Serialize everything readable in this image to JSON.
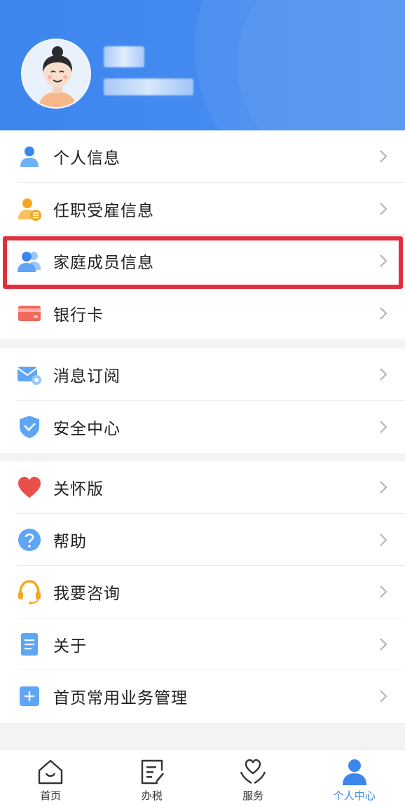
{
  "profile": {
    "avatar_icon": "female-avatar",
    "name_masked": "",
    "id_masked": ""
  },
  "groups": [
    {
      "items": [
        {
          "label": "个人信息",
          "icon": "person-icon"
        },
        {
          "label": "任职受雇信息",
          "icon": "employment-icon"
        },
        {
          "label": "家庭成员信息",
          "icon": "family-icon",
          "highlighted": true
        },
        {
          "label": "银行卡",
          "icon": "bank-card-icon"
        }
      ]
    },
    {
      "items": [
        {
          "label": "消息订阅",
          "icon": "message-subscribe-icon"
        },
        {
          "label": "安全中心",
          "icon": "shield-icon"
        }
      ]
    },
    {
      "items": [
        {
          "label": "关怀版",
          "icon": "heart-icon"
        },
        {
          "label": "帮助",
          "icon": "help-icon"
        },
        {
          "label": "我要咨询",
          "icon": "headset-icon"
        },
        {
          "label": "关于",
          "icon": "document-icon"
        },
        {
          "label": "首页常用业务管理",
          "icon": "add-square-icon"
        }
      ]
    }
  ],
  "tabbar": [
    {
      "label": "首页",
      "icon": "home-icon",
      "active": false
    },
    {
      "label": "办税",
      "icon": "edit-document-icon",
      "active": false
    },
    {
      "label": "服务",
      "icon": "heart-hands-icon",
      "active": false
    },
    {
      "label": "个人中心",
      "icon": "user-center-icon",
      "active": true
    }
  ],
  "colors": {
    "primary": "#3d86ee",
    "highlight_border": "#e0303f"
  }
}
